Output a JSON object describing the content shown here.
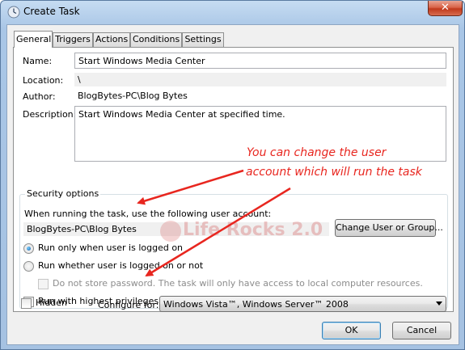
{
  "window": {
    "title": "Create Task",
    "close_glyph": "✕"
  },
  "tabs": [
    {
      "label": "General"
    },
    {
      "label": "Triggers"
    },
    {
      "label": "Actions"
    },
    {
      "label": "Conditions"
    },
    {
      "label": "Settings"
    }
  ],
  "general": {
    "name_label": "Name:",
    "name_value": "Start Windows Media Center",
    "location_label": "Location:",
    "location_value": "\\",
    "author_label": "Author:",
    "author_value": "BlogBytes-PC\\Blog Bytes",
    "description_label": "Description:",
    "description_value": "Start Windows Media Center at specified time."
  },
  "security": {
    "group_title": "Security options",
    "account_prompt": "When running the task, use the following user account:",
    "account_value": "BlogBytes-PC\\Blog Bytes",
    "change_button": "Change User or Group...",
    "radio_logged_on": "Run only when user is logged on",
    "radio_whether": "Run whether user is logged on or not",
    "no_store_password": "Do not store password.  The task will only have access to local computer resources.",
    "highest_privileges": "Run with highest privileges"
  },
  "footer": {
    "hidden_label": "Hidden",
    "configure_label": "Configure for:",
    "configure_value": "Windows Vista™, Windows Server™ 2008",
    "ok_button": "OK",
    "cancel_button": "Cancel"
  },
  "annotation": {
    "line1": "You can change the user",
    "line2": "account which will run the task",
    "color": "#e8261f"
  },
  "watermark": {
    "text": "Life Rocks 2.0"
  }
}
